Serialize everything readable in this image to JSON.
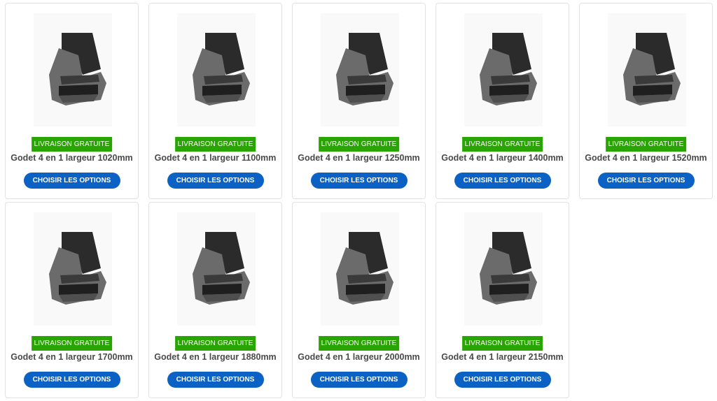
{
  "products": [
    {
      "badge": "LIVRAISON GRATUITE",
      "title": "Godet 4 en 1 largeur 1020mm",
      "button": "CHOISIR LES OPTIONS"
    },
    {
      "badge": "LIVRAISON GRATUITE",
      "title": "Godet 4 en 1 largeur 1100mm",
      "button": "CHOISIR LES OPTIONS"
    },
    {
      "badge": "LIVRAISON GRATUITE",
      "title": "Godet 4 en 1 largeur 1250mm",
      "button": "CHOISIR LES OPTIONS"
    },
    {
      "badge": "LIVRAISON GRATUITE",
      "title": "Godet 4 en 1 largeur 1400mm",
      "button": "CHOISIR LES OPTIONS"
    },
    {
      "badge": "LIVRAISON GRATUITE",
      "title": "Godet 4 en 1 largeur 1520mm",
      "button": "CHOISIR LES OPTIONS"
    },
    {
      "badge": "LIVRAISON GRATUITE",
      "title": "Godet 4 en 1 largeur 1700mm",
      "button": "CHOISIR LES OPTIONS"
    },
    {
      "badge": "LIVRAISON GRATUITE",
      "title": "Godet 4 en 1 largeur 1880mm",
      "button": "CHOISIR LES OPTIONS"
    },
    {
      "badge": "LIVRAISON GRATUITE",
      "title": "Godet 4 en 1 largeur 2000mm",
      "button": "CHOISIR LES OPTIONS"
    },
    {
      "badge": "LIVRAISON GRATUITE",
      "title": "Godet 4 en 1 largeur 2150mm",
      "button": "CHOISIR LES OPTIONS"
    }
  ],
  "colors": {
    "badge": "#28a500",
    "button": "#0b62c4",
    "title": "#4a4a4a"
  },
  "product_image_icon": "bucket-image"
}
